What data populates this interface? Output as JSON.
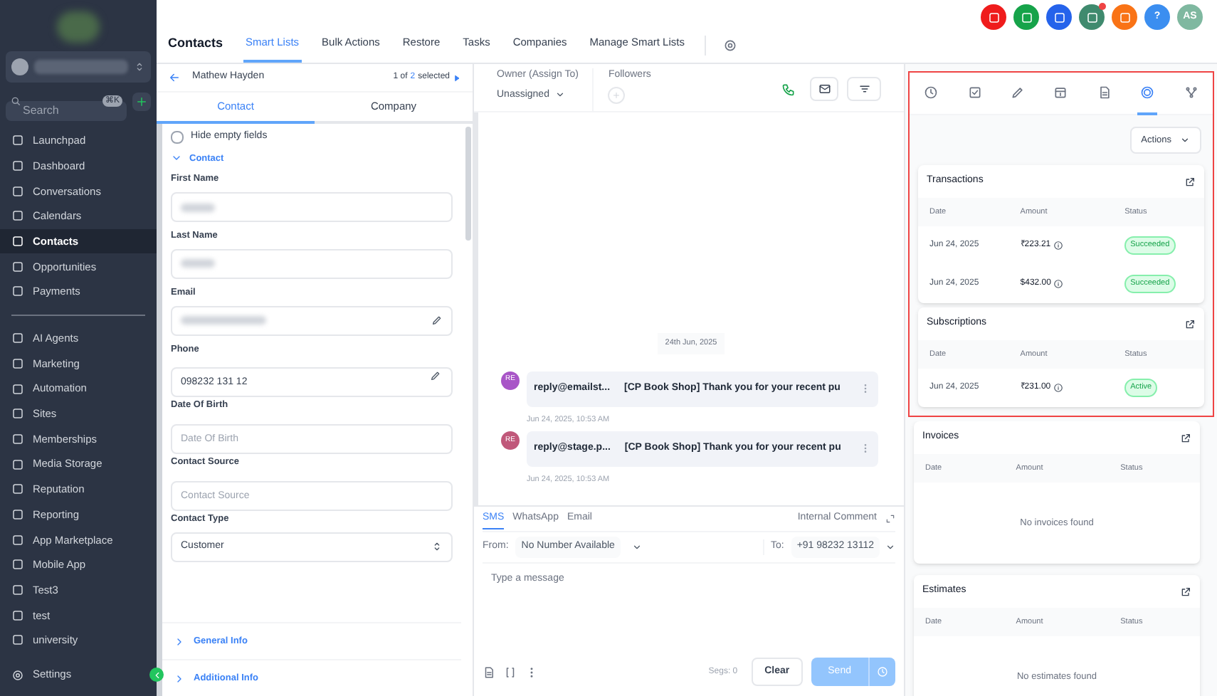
{
  "sidebar": {
    "search": {
      "placeholder": "Search",
      "shortcut": "⌘K"
    },
    "nav_primary": [
      {
        "label": "Launchpad",
        "selected": false
      },
      {
        "label": "Dashboard",
        "selected": false
      },
      {
        "label": "Conversations",
        "selected": false
      },
      {
        "label": "Calendars",
        "selected": false
      },
      {
        "label": "Contacts",
        "selected": true
      },
      {
        "label": "Opportunities",
        "selected": false
      },
      {
        "label": "Payments",
        "selected": false
      }
    ],
    "nav_secondary": [
      {
        "label": "AI Agents",
        "selected": false
      },
      {
        "label": "Marketing",
        "selected": false
      },
      {
        "label": "Automation",
        "selected": false
      },
      {
        "label": "Sites",
        "selected": false
      },
      {
        "label": "Memberships",
        "selected": false
      },
      {
        "label": "Media Storage",
        "selected": false
      },
      {
        "label": "Reputation",
        "selected": false
      },
      {
        "label": "Reporting",
        "selected": false
      },
      {
        "label": "App Marketplace",
        "selected": false
      },
      {
        "label": "Mobile App",
        "selected": false
      },
      {
        "label": "Test3",
        "selected": false
      },
      {
        "label": "test",
        "selected": false
      },
      {
        "label": "university",
        "selected": false
      }
    ],
    "settings": "Settings"
  },
  "header": {
    "title": "Contacts",
    "tabs": [
      {
        "label": "Smart Lists",
        "selected": true
      },
      {
        "label": "Bulk Actions",
        "selected": false
      },
      {
        "label": "Restore",
        "selected": false
      },
      {
        "label": "Tasks",
        "selected": false
      },
      {
        "label": "Companies",
        "selected": false
      },
      {
        "label": "Manage Smart Lists",
        "selected": false
      }
    ],
    "top_buttons": [
      {
        "color": "#ef1c1c"
      },
      {
        "color": "#16a34a"
      },
      {
        "color": "#2563eb"
      },
      {
        "color": "#3f8a6e",
        "badge": true
      },
      {
        "color": "#f97316"
      },
      {
        "color": "#3b8ef0",
        "text": "?"
      },
      {
        "color": "#7fb8a0",
        "text": "AS"
      }
    ]
  },
  "contact_panel": {
    "name": "Mathew Hayden",
    "pager": "1 of",
    "pager_count": "2",
    "pager_suffix": "selected",
    "tabs": [
      {
        "label": "Contact",
        "selected": true
      },
      {
        "label": "Company",
        "selected": false
      }
    ],
    "hide_empty": {
      "label": "Hide empty fields",
      "checked": false
    },
    "section": "Contact",
    "fields": [
      {
        "label": "First Name",
        "kind": "blurred"
      },
      {
        "label": "Last Name",
        "kind": "blurred"
      },
      {
        "label": "Email",
        "kind": "blurred",
        "editable": true
      },
      {
        "label": "Phone",
        "kind": "text",
        "value": "098232 131 12",
        "editable": true
      },
      {
        "label": "Date Of Birth",
        "kind": "text",
        "placeholder": "Date Of Birth"
      },
      {
        "label": "Contact Source",
        "kind": "text",
        "placeholder": "Contact Source"
      },
      {
        "label": "Contact Type",
        "kind": "select",
        "value": "Customer"
      }
    ],
    "collapsed_sections": [
      "General Info",
      "Additional Info"
    ]
  },
  "conversation": {
    "owner_label": "Owner (Assign To)",
    "owner_value": "Unassigned",
    "followers_label": "Followers",
    "date_chip": "24th Jun, 2025",
    "messages": [
      {
        "avatar": "RE",
        "color": "#a855c7",
        "sender": "reply@emailst...",
        "subject": "[CP Book Shop] Thank you for your recent pu",
        "time": "Jun 24, 2025, 10:53 AM"
      },
      {
        "avatar": "RE",
        "color": "#c0587a",
        "sender": "reply@stage.p...",
        "subject": "[CP Book Shop] Thank you for your recent pu",
        "time": "Jun 24, 2025, 10:53 AM"
      }
    ],
    "composer": {
      "tabs": [
        {
          "label": "SMS",
          "selected": true
        },
        {
          "label": "WhatsApp",
          "selected": false
        },
        {
          "label": "Email",
          "selected": false
        }
      ],
      "internal_comment": "Internal Comment",
      "from_label": "From:",
      "from_value": "No Number Available",
      "to_label": "To:",
      "to_value": "+91 98232 13112",
      "placeholder": "Type a message",
      "segments": "Segs: 0",
      "clear": "Clear",
      "send": "Send"
    }
  },
  "payments_panel": {
    "tabs": [
      {
        "selected": false
      },
      {
        "selected": false
      },
      {
        "selected": false
      },
      {
        "selected": false
      },
      {
        "selected": false
      },
      {
        "selected": true
      },
      {
        "selected": false
      }
    ],
    "actions": "Actions",
    "sections": [
      {
        "title": "Transactions",
        "columns": [
          "Date",
          "Amount",
          "Status"
        ],
        "rows": [
          {
            "date": "Jun 24, 2025",
            "amount": "₹223.21",
            "status": "Succeeded"
          },
          {
            "date": "Jun 24, 2025",
            "amount": "$432.00",
            "status": "Succeeded"
          }
        ],
        "highlighted": true
      },
      {
        "title": "Subscriptions",
        "columns": [
          "Date",
          "Amount",
          "Status"
        ],
        "rows": [
          {
            "date": "Jun 24, 2025",
            "amount": "₹231.00",
            "status": "Active"
          }
        ],
        "highlighted": true
      },
      {
        "title": "Invoices",
        "columns": [
          "Date",
          "Amount",
          "Status"
        ],
        "empty": "No invoices found",
        "highlighted": false
      },
      {
        "title": "Estimates",
        "columns": [
          "Date",
          "Amount",
          "Status"
        ],
        "empty": "No estimates found",
        "highlighted": false
      }
    ]
  }
}
